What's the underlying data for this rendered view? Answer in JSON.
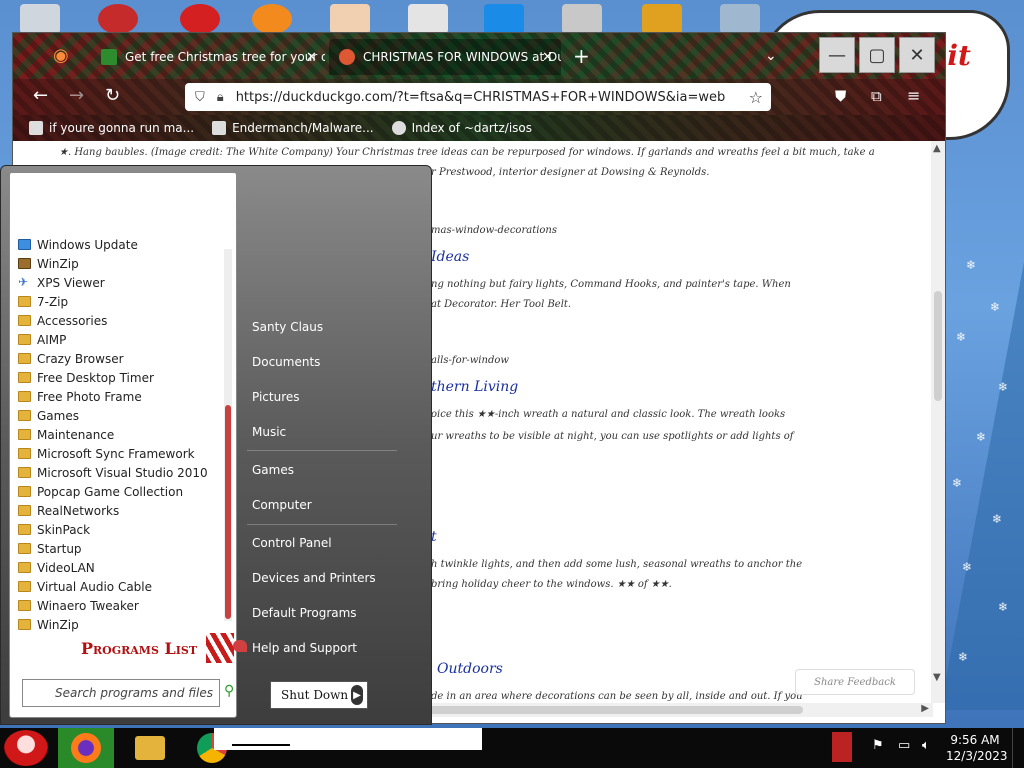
{
  "desktop": {
    "bubble_text": "mit"
  },
  "browser": {
    "tabs": [
      {
        "title": "Get free Christmas tree for your de",
        "active": false
      },
      {
        "title": "CHRISTMAS FOR WINDOWS at Du",
        "active": true
      }
    ],
    "new_tab_symbol": "+",
    "url": "https://duckduckgo.com/?t=ftsa&q=CHRISTMAS+FOR+WINDOWS&ia=web",
    "bookmarks": [
      "if youre gonna run ma...",
      "Endermanch/Malware...",
      "Index of ~dartz/isos"
    ],
    "page_lines": [
      "★. Hang baubles. (Image credit: The White Company) Your Christmas tree ideas can be repurposed for windows. If garlands and wreaths feel a bit much, take a",
      "r Prestwood, interior designer at Dowsing & Reynolds.",
      "mas-window-decorations",
      "Ideas",
      "ng nothing but fairy lights, Command Hooks, and painter's tape. When",
      "at Decorator. Her Tool Belt.",
      "alls-for-window",
      "thern Living",
      "oice this ★★-inch wreath a natural and classic look. The wreath looks",
      "ur wreaths to be visible at night, you can use spotlights or add lights of",
      "t",
      "h twinkle lights, and then add some lush, seasonal wreaths to anchor the",
      "bring holiday cheer to the windows. ★★ of ★★.",
      "Outdoors",
      "de in an area where decorations can be seen by all, inside and out. If you"
    ],
    "feedback_label": "Share Feedback"
  },
  "startmenu": {
    "programs": [
      "Windows Update",
      "WinZip",
      "XPS Viewer",
      "7-Zip",
      "Accessories",
      "AIMP",
      "Crazy Browser",
      "Free Desktop Timer",
      "Free Photo Frame",
      "Games",
      "Maintenance",
      "Microsoft Sync Framework",
      "Microsoft Visual Studio 2010",
      "Popcap Game Collection",
      "RealNetworks",
      "SkinPack",
      "Startup",
      "VideoLAN",
      "Virtual Audio Cable",
      "Winaero Tweaker",
      "WinZip"
    ],
    "programs_list_label": "Programs List",
    "search_placeholder": "Search programs and files",
    "right_items": [
      "Santy Claus",
      "Documents",
      "Pictures",
      "Music",
      "Games",
      "Computer",
      "Control Panel",
      "Devices and Printers",
      "Default Programs",
      "Help and Support"
    ],
    "shutdown_label": "Shut Down"
  },
  "taskbar": {
    "time": "9:56 AM",
    "date": "12/3/2023"
  }
}
